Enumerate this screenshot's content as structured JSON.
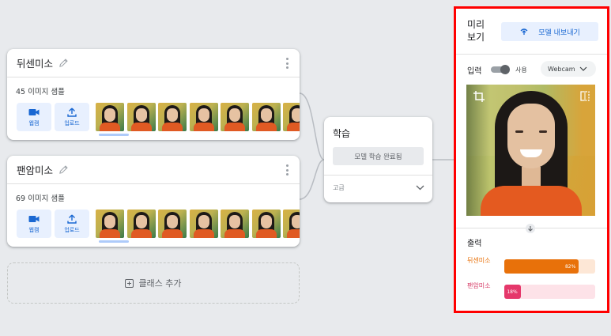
{
  "classes": [
    {
      "name": "뒤센미소",
      "sample_count": "45 이미지 샘플",
      "thumb_count": 7
    },
    {
      "name": "팬암미소",
      "sample_count": "69 이미지 샘플",
      "thumb_count": 7
    }
  ],
  "tools": {
    "webcam_label": "웹캠",
    "upload_label": "업로드"
  },
  "add_class": {
    "label": "클래스 추가"
  },
  "training": {
    "title": "학습",
    "button_label": "모델 학습 완료됨",
    "advanced_label": "고급"
  },
  "preview": {
    "title": "미리 보기",
    "export_label": "모델 내보내기",
    "input_label": "입력",
    "toggle_label": "사용",
    "toggle_on": true,
    "source_select": "Webcam",
    "output_label": "출력",
    "outputs": [
      {
        "name": "뒤센미소",
        "percent_label": "82%",
        "value": 0.82,
        "color": "#e8710a",
        "track": "#fde7d6",
        "text_color": "#e8710a"
      },
      {
        "name": "팬암미소",
        "percent_label": "18%",
        "value": 0.18,
        "color": "#e5386b",
        "track": "#fde2e8",
        "text_color": "#d63864"
      }
    ]
  },
  "colors": {
    "accent": "#1967d2",
    "highlight_border": "#ff0000",
    "background": "#e8eaed"
  }
}
